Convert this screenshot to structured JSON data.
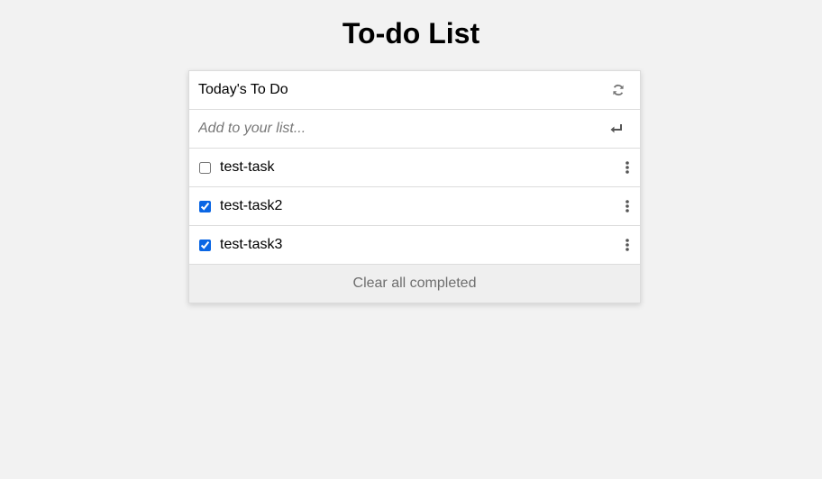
{
  "app": {
    "title": "To-do List"
  },
  "list": {
    "name": "Today's To Do",
    "add_placeholder": "Add to your list...",
    "tasks": [
      {
        "label": "test-task",
        "done": false
      },
      {
        "label": "test-task2",
        "done": true
      },
      {
        "label": "test-task3",
        "done": true
      }
    ],
    "clear_label": "Clear all completed"
  },
  "icons": {
    "refresh": "refresh-icon",
    "enter": "enter-icon",
    "menu": "kebab-menu-icon"
  },
  "colors": {
    "background": "#f2f2f2",
    "checkbox_accent": "#0a66e4",
    "muted_text": "#6e6e6e"
  }
}
